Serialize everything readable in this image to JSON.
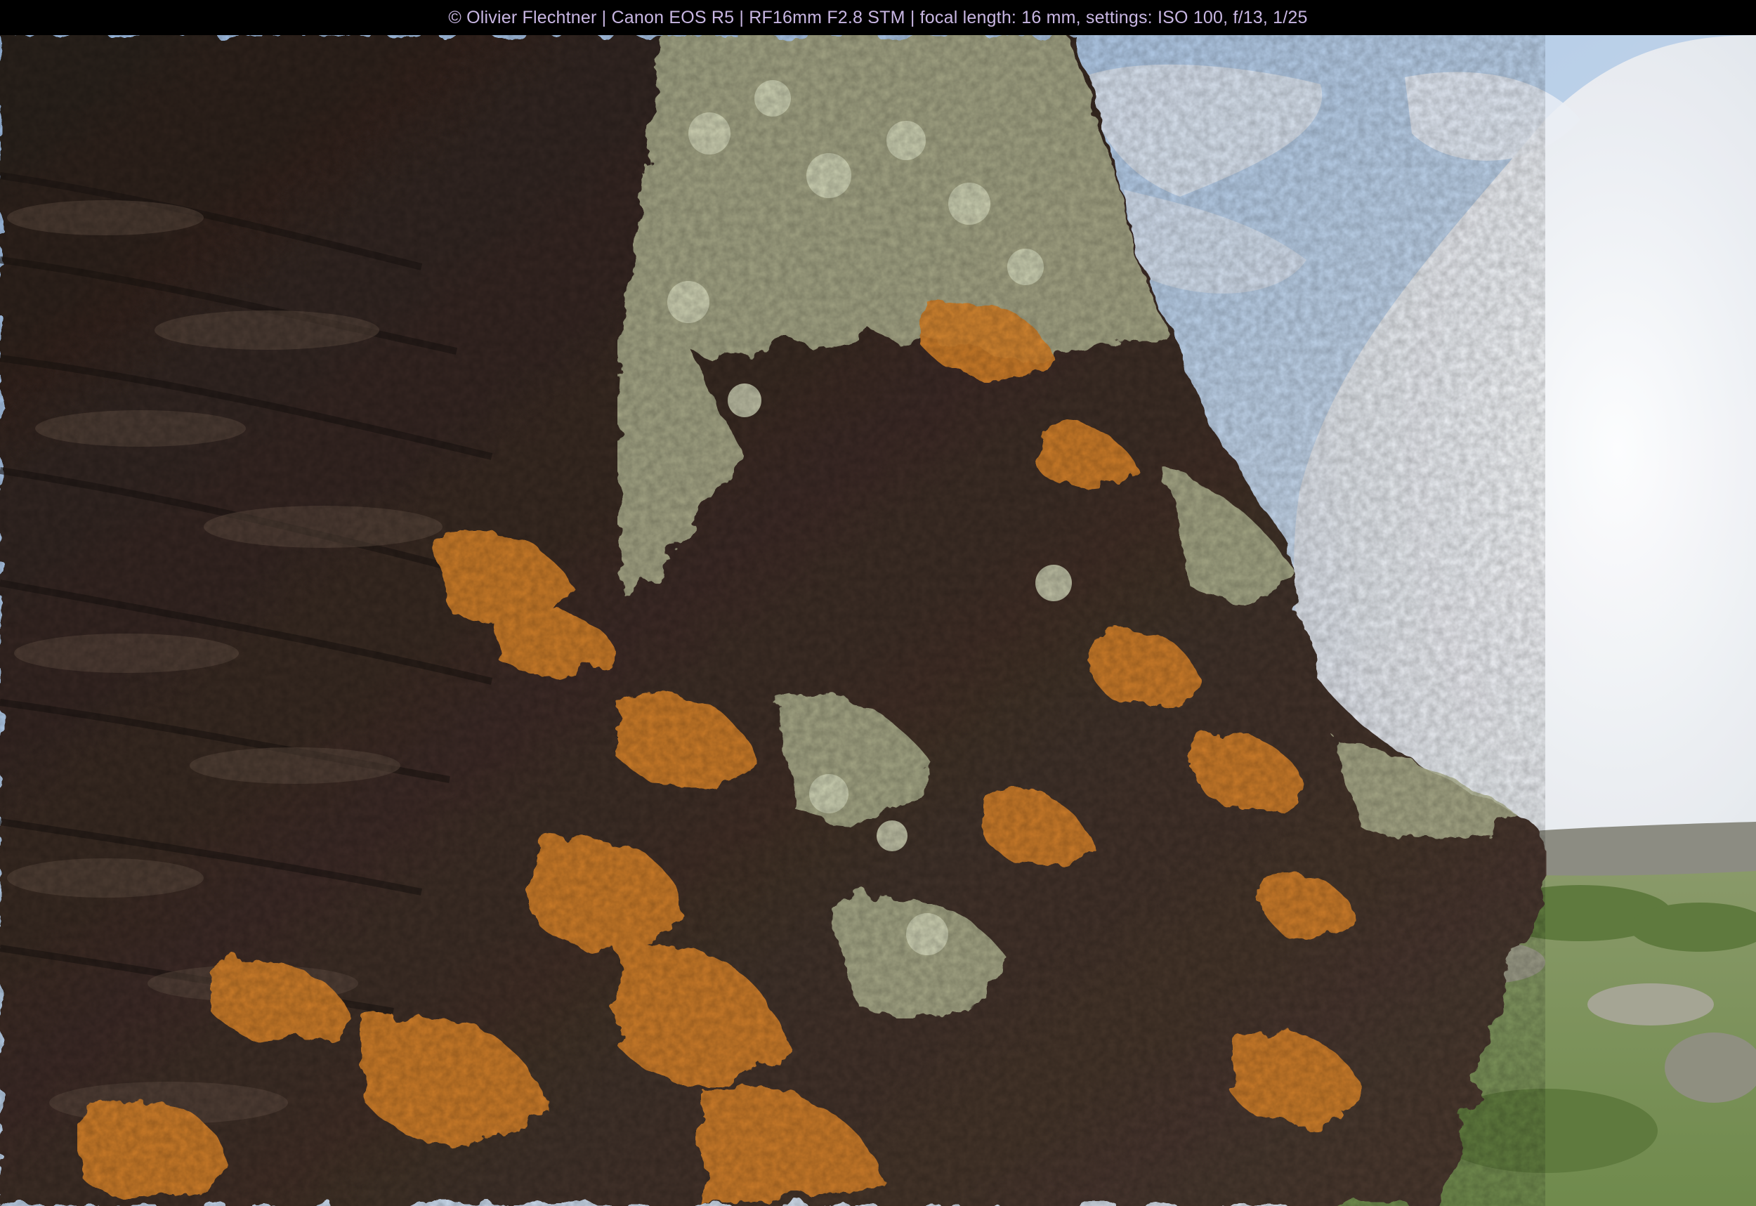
{
  "caption": {
    "text": "© Olivier Flechtner | Canon EOS R5 | RF16mm F2.8 STM | focal length: 16 mm, settings: ISO 100, f/13, 1/25",
    "color": "#c8b6e2"
  },
  "photo": {
    "subject": "lichen-covered rock cliff",
    "colors": {
      "sky": "#8fb3e0",
      "cloud": "#eceef2",
      "rock_dark": "#3a2b25",
      "lichen_orange": "#d9832e",
      "lichen_pale": "#b9bc9c",
      "grass": "#7e9558"
    }
  }
}
